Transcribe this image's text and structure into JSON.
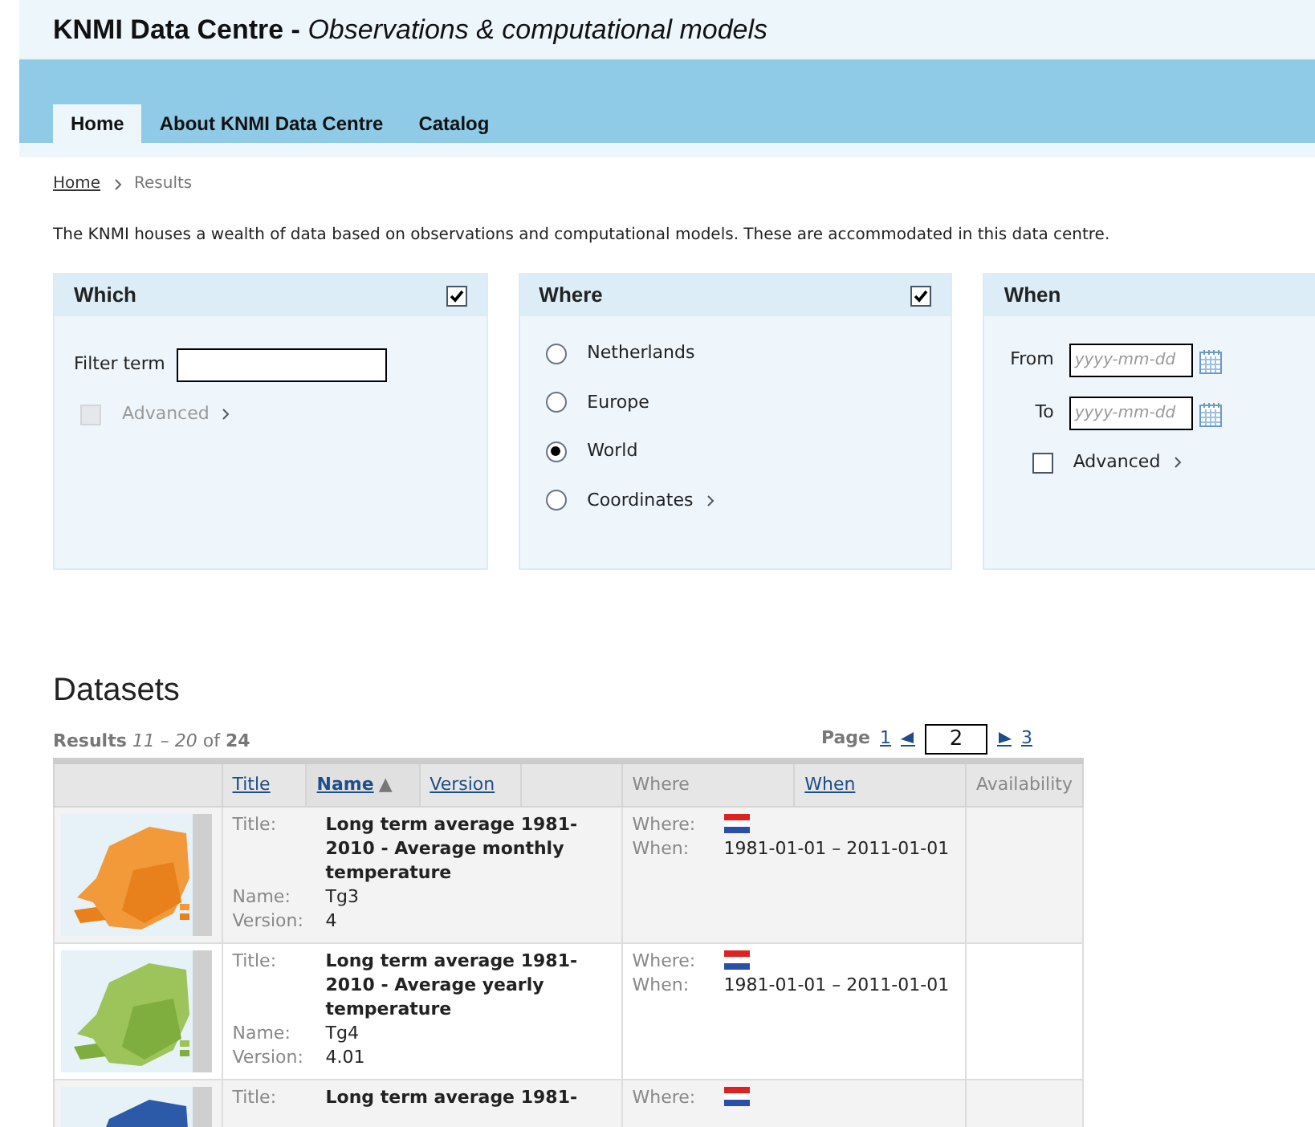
{
  "header": {
    "title": "KNMI Data Centre -",
    "subtitle": "Observations & computational models"
  },
  "nav_tabs": [
    {
      "label": "Home",
      "selected": true
    },
    {
      "label": "About KNMI Data Centre",
      "selected": false
    },
    {
      "label": "Catalog",
      "selected": false
    }
  ],
  "breadcrumb": [
    {
      "label": "Home",
      "kind": "link"
    },
    {
      "label": "Results",
      "kind": "current"
    }
  ],
  "intro": "The KNMI houses a wealth of data based on observations and computational models. These are accommodated in this data centre.",
  "which": {
    "title": "Which",
    "checked": true,
    "filter_label": "Filter term",
    "advanced": {
      "label": "Advanced",
      "checked": false,
      "disabled": true
    }
  },
  "where": {
    "title": "Where",
    "checked": true,
    "options": [
      {
        "label": "Netherlands",
        "selected": false,
        "expandable": false
      },
      {
        "label": "Europe",
        "selected": false,
        "expandable": false
      },
      {
        "label": "World",
        "selected": true,
        "expandable": false
      },
      {
        "label": "Coordinates",
        "selected": false,
        "expandable": true
      }
    ]
  },
  "when": {
    "title": "When",
    "from": {
      "label": "From",
      "placeholder": "yyyy-mm-dd"
    },
    "to": {
      "label": "To",
      "placeholder": "yyyy-mm-dd"
    },
    "advanced": {
      "label": "Advanced",
      "checked": false,
      "disabled": false
    }
  },
  "datasets": {
    "heading": "Datasets",
    "results": "**Results** *11 – 20* of **24**",
    "pagination": {
      "label": "Page",
      "first": "1",
      "current": "2",
      "last": "3"
    },
    "columns": [
      {
        "kind": "blank"
      },
      {
        "label": "Title",
        "kind": "link",
        "sorted": false
      },
      {
        "label": "Name",
        "kind": "link",
        "sorted": true,
        "arrow": "▲"
      },
      {
        "label": "Version",
        "kind": "link",
        "sorted": false
      },
      {
        "kind": "blank"
      },
      {
        "label": "Where",
        "kind": "plain"
      },
      {
        "label": "When",
        "kind": "link",
        "sorted": false
      },
      {
        "label": "Availability",
        "kind": "plain"
      }
    ],
    "rows": [
      {
        "title_label": "Title:",
        "title": "Long term average 1981-2010 - Average monthly temperature",
        "name_label": "Name:",
        "name": "Tg3",
        "version_label": "Version:",
        "version": "4",
        "where_label": "Where:",
        "when_label": "When:",
        "when": "1981-01-01 – 2011-01-01"
      },
      {
        "title_label": "Title:",
        "title": "Long term average 1981-2010 - Average yearly temperature",
        "name_label": "Name:",
        "name": "Tg4",
        "version_label": "Version:",
        "version": "4.01",
        "where_label": "Where:",
        "when_label": "When:",
        "when": "1981-01-01 – 2011-01-01"
      },
      {
        "title_label": "Title:",
        "title": "Long term average 1981-",
        "where_label": "Where:"
      }
    ]
  }
}
